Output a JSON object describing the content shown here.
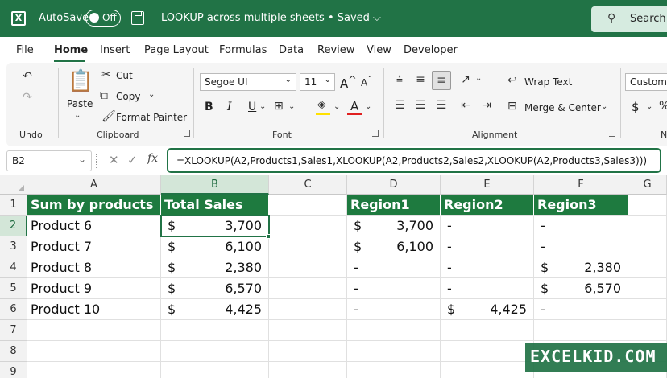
{
  "titlebar": {
    "autosave_label": "AutoSave",
    "autosave_state": "Off",
    "doc_title": "LOOKUP across multiple sheets • Saved ⌵",
    "search_label": "Search",
    "accent": "#217346"
  },
  "menu": {
    "tabs": [
      "File",
      "Home",
      "Insert",
      "Page Layout",
      "Formulas",
      "Data",
      "Review",
      "View",
      "Developer"
    ],
    "active": "Home"
  },
  "ribbon": {
    "undo_group": "Undo",
    "clipboard": {
      "group": "Clipboard",
      "paste": "Paste",
      "cut": "Cut",
      "copy": "Copy",
      "format_painter": "Format Painter"
    },
    "font": {
      "group": "Font",
      "name": "Segoe UI",
      "size": "11",
      "bold": "B",
      "italic": "I",
      "underline": "U",
      "font_color_letter": "A"
    },
    "alignment": {
      "group": "Alignment",
      "wrap_text": "Wrap Text",
      "merge_center": "Merge & Center"
    },
    "number": {
      "format": "Custom",
      "currency_symbol": "$",
      "group_truncated": "N"
    }
  },
  "formula_bar": {
    "name_box": "B2",
    "formula": "=XLOOKUP(A2,Products1,Sales1,XLOOKUP(A2,Products2,Sales2,XLOOKUP(A2,Products3,Sales3)))"
  },
  "sheet": {
    "columns": [
      "A",
      "B",
      "C",
      "D",
      "E",
      "F",
      "G"
    ],
    "rows": [
      "1",
      "2",
      "3",
      "4",
      "5",
      "6",
      "7",
      "8",
      "9"
    ],
    "header_a": "Sum by products",
    "header_b": "Total Sales",
    "header_d": "Region1",
    "header_e": "Region2",
    "header_f": "Region3",
    "currency": "$",
    "dash": "-",
    "data": [
      {
        "product": "Product 6",
        "total": "3,700",
        "r1": "3,700",
        "r2": "-",
        "r3": "-"
      },
      {
        "product": "Product 7",
        "total": "6,100",
        "r1": "6,100",
        "r2": "-",
        "r3": "-"
      },
      {
        "product": "Product 8",
        "total": "2,380",
        "r1": "-",
        "r2": "-",
        "r3": "2,380"
      },
      {
        "product": "Product 9",
        "total": "6,570",
        "r1": "-",
        "r2": "-",
        "r3": "6,570"
      },
      {
        "product": "Product 10",
        "total": "4,425",
        "r1": "-",
        "r2": "4,425",
        "r3": "-"
      }
    ]
  },
  "watermark": "EXCELKID.COM"
}
